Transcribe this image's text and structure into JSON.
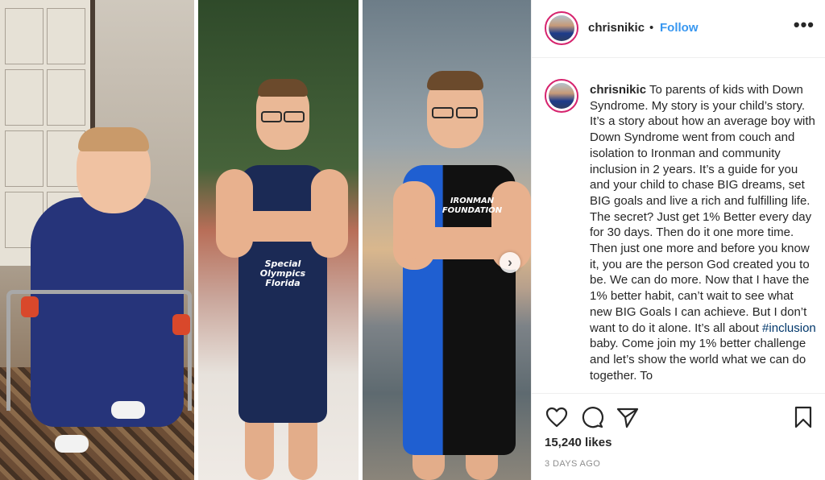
{
  "post": {
    "username": "chrisnikic",
    "follow_label": "Follow",
    "separator": "•",
    "more_label": "•••",
    "caption": {
      "username": "chrisnikic",
      "text_before_hashtag": "To parents of kids with Down Syndrome. My story is your child’s story. It’s a story about how an average boy with Down Syndrome went from couch and isolation to Ironman and community inclusion in 2 years. It’s a guide for you and your child to chase BIG dreams, set BIG goals and live a rich and fulfilling life. The secret? Just get 1% Better every day for 30 days. Then do it one more time. Then just one more and before you know it, you are the person God created you to be. We can do more. Now that I have the 1% better habit, can’t wait to see what new BIG Goals I can achieve. But I don’t want to do it alone. It’s all about",
      "hashtag": "#inclusion",
      "text_after_hashtag": "baby. Come join my 1% better challenge and let’s show the world what we can do together. To"
    },
    "likes": "15,240 likes",
    "date": "3 DAYS AGO"
  },
  "media": {
    "panel2_suit_text": "Special\nOlympics\nFlorida",
    "panel3_suit_text": "IRONMAN\nFOUNDATION",
    "next_icon": "chevron-right-icon"
  },
  "colors": {
    "link_blue": "#3897f0",
    "hashtag_blue": "#00376b",
    "text": "#262626",
    "secondary": "#8e8e8e",
    "story_ring": "#d6246e"
  }
}
